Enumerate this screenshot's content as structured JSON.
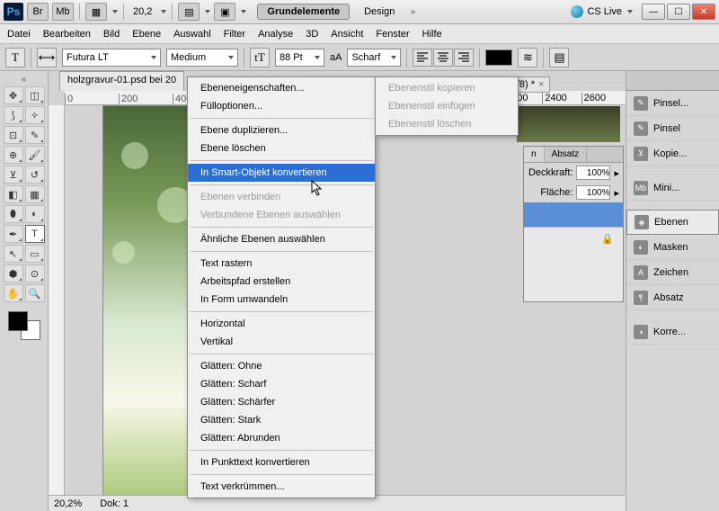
{
  "titlebar": {
    "zoom": "20,2",
    "workspace_active": "Grundelemente",
    "workspace_other": "Design",
    "cs_live": "CS Live"
  },
  "menubar": [
    "Datei",
    "Bearbeiten",
    "Bild",
    "Ebene",
    "Auswahl",
    "Filter",
    "Analyse",
    "3D",
    "Ansicht",
    "Fenster",
    "Hilfe"
  ],
  "options": {
    "font_family": "Futura LT",
    "font_style": "Medium",
    "font_size": "88 Pt",
    "aa_label": "aA",
    "aa_value": "Scharf"
  },
  "doc_tab": "holzgravur-01.psd bei 20",
  "ruler_marks": [
    "0",
    "200",
    "400"
  ],
  "status": {
    "zoom": "20,2%",
    "dok": "Dok: 1"
  },
  "context_menu": {
    "items": [
      {
        "label": "Ebeneneigenschaften...",
        "type": "item"
      },
      {
        "label": "Fülloptionen...",
        "type": "item"
      },
      {
        "type": "sep"
      },
      {
        "label": "Ebene duplizieren...",
        "type": "item"
      },
      {
        "label": "Ebene löschen",
        "type": "item"
      },
      {
        "type": "sep"
      },
      {
        "label": "In Smart-Objekt konvertieren",
        "type": "item",
        "highlighted": true
      },
      {
        "type": "sep"
      },
      {
        "label": "Ebenen verbinden",
        "type": "item",
        "disabled": true
      },
      {
        "label": "Verbundene Ebenen auswählen",
        "type": "item",
        "disabled": true
      },
      {
        "type": "sep"
      },
      {
        "label": "Ähnliche Ebenen auswählen",
        "type": "item"
      },
      {
        "type": "sep"
      },
      {
        "label": "Text rastern",
        "type": "item"
      },
      {
        "label": "Arbeitspfad erstellen",
        "type": "item"
      },
      {
        "label": "In Form umwandeln",
        "type": "item"
      },
      {
        "type": "sep"
      },
      {
        "label": "Horizontal",
        "type": "item"
      },
      {
        "label": "Vertikal",
        "type": "item"
      },
      {
        "type": "sep"
      },
      {
        "label": "Glätten: Ohne",
        "type": "item"
      },
      {
        "label": "Glätten: Scharf",
        "type": "item"
      },
      {
        "label": "Glätten: Schärfer",
        "type": "item"
      },
      {
        "label": "Glätten: Stark",
        "type": "item"
      },
      {
        "label": "Glätten: Abrunden",
        "type": "item"
      },
      {
        "type": "sep"
      },
      {
        "label": "In Punkttext konvertieren",
        "type": "item"
      },
      {
        "type": "sep"
      },
      {
        "label": "Text verkrümmen...",
        "type": "item"
      }
    ]
  },
  "submenu": {
    "items": [
      {
        "label": "Ebenenstil kopieren",
        "disabled": true
      },
      {
        "label": "Ebenenstil einfügen",
        "disabled": true
      },
      {
        "label": "Ebenenstil löschen",
        "disabled": true
      }
    ]
  },
  "tab2": {
    "label": "RGB/8) *"
  },
  "ruler2_marks": [
    "2200",
    "2400",
    "2600"
  ],
  "layers_panel": {
    "tabs": [
      "n",
      "Absatz"
    ],
    "opacity_label": "Deckkraft:",
    "opacity_value": "100%",
    "fill_label": "Fläche:",
    "fill_value": "100%"
  },
  "dock": {
    "items": [
      {
        "label": "Pinsel...",
        "name": "dock-brush-presets"
      },
      {
        "label": "Pinsel",
        "name": "dock-brush"
      },
      {
        "label": "Kopie...",
        "name": "dock-clone"
      }
    ],
    "items2": [
      {
        "label": "Mini...",
        "name": "dock-mini-bridge",
        "ico": "Mb"
      }
    ],
    "items3": [
      {
        "label": "Ebenen",
        "name": "dock-layers",
        "sel": true
      },
      {
        "label": "Masken",
        "name": "dock-masks"
      },
      {
        "label": "Zeichen",
        "name": "dock-character"
      },
      {
        "label": "Absatz",
        "name": "dock-paragraph"
      }
    ],
    "items4": [
      {
        "label": "Korre...",
        "name": "dock-adjustments"
      }
    ]
  }
}
